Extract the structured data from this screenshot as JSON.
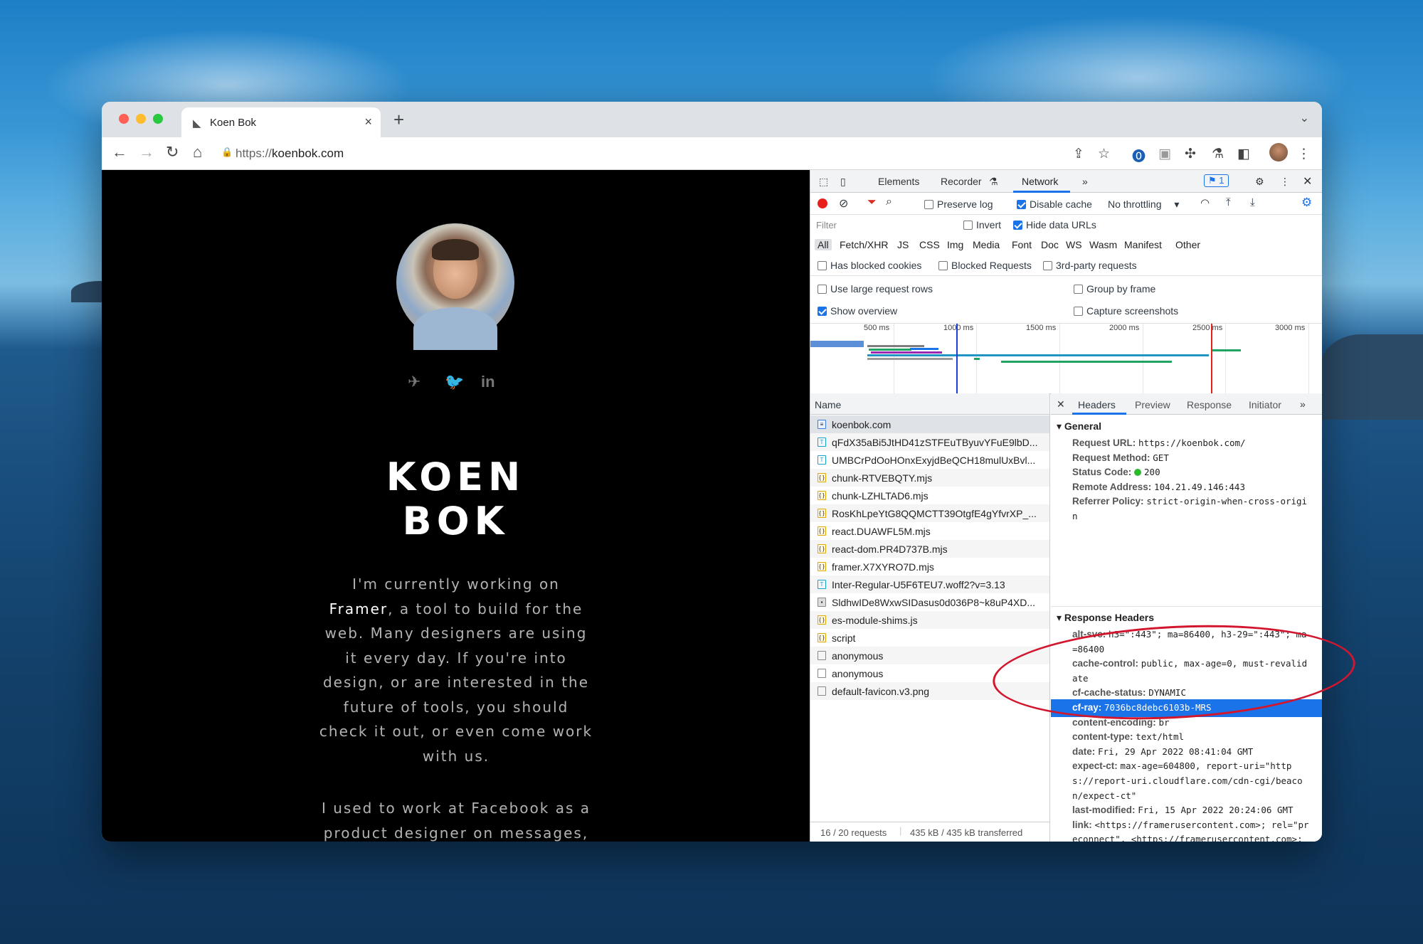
{
  "browser": {
    "tab_title": "Koen Bok",
    "new_tab": "+",
    "url_scheme": "https://",
    "url_host": "koenbok.com"
  },
  "page": {
    "name_line1": "KOEN",
    "name_line2": "BOK",
    "bio_lines": [
      "I'm currently working on",
      "Framer, a tool to build for the",
      "web. Many designers are using",
      "it every day. If you're into",
      "design, or are interested in the",
      "future of tools, you should",
      "check it out, or even come work",
      "with us."
    ],
    "bio_link": "Framer",
    "bio2_lines": [
      "I used to work at Facebook as a",
      "product designer on messages,"
    ]
  },
  "devtools": {
    "tabs": [
      "Elements",
      "Recorder",
      "Network"
    ],
    "active_tab": "Network",
    "more": "»",
    "issues_count": "1",
    "toolbar": {
      "preserve_log": "Preserve log",
      "disable_cache": "Disable cache",
      "throttling": "No throttling"
    },
    "filter": {
      "placeholder": "Filter",
      "invert": "Invert",
      "hide_data_urls": "Hide data URLs"
    },
    "types": [
      "All",
      "Fetch/XHR",
      "JS",
      "CSS",
      "Img",
      "Media",
      "Font",
      "Doc",
      "WS",
      "Wasm",
      "Manifest",
      "Other"
    ],
    "options": {
      "blocked_cookies": "Has blocked cookies",
      "blocked_requests": "Blocked Requests",
      "third_party": "3rd-party requests",
      "large_rows": "Use large request rows",
      "group_by_frame": "Group by frame",
      "show_overview": "Show overview",
      "capture_screenshots": "Capture screenshots"
    },
    "overview_ticks": [
      "500 ms",
      "1000 ms",
      "1500 ms",
      "2000 ms",
      "2500 ms",
      "3000 ms"
    ],
    "name_header": "Name",
    "requests": [
      {
        "name": "koenbok.com",
        "type": "doc"
      },
      {
        "name": "qFdX35aBi5JtHD41zSTFEuTByuvYFuE9lbD...",
        "type": "font"
      },
      {
        "name": "UMBCrPdOoHOnxExyjdBeQCH18mulUxBvl...",
        "type": "font"
      },
      {
        "name": "chunk-RTVEBQTY.mjs",
        "type": "js"
      },
      {
        "name": "chunk-LZHLTAD6.mjs",
        "type": "js"
      },
      {
        "name": "RosKhLpeYtG8QQMCTT39OtgfE4gYfvrXP_...",
        "type": "js"
      },
      {
        "name": "react.DUAWFL5M.mjs",
        "type": "js"
      },
      {
        "name": "react-dom.PR4D737B.mjs",
        "type": "js"
      },
      {
        "name": "framer.X7XYRO7D.mjs",
        "type": "js"
      },
      {
        "name": "Inter-Regular-U5F6TEU7.woff2?v=3.13",
        "type": "font"
      },
      {
        "name": "SldhwIDe8WxwSIDasus0d036P8~k8uP4XD...",
        "type": "img"
      },
      {
        "name": "es-module-shims.js",
        "type": "js"
      },
      {
        "name": "script",
        "type": "js"
      },
      {
        "name": "anonymous",
        "type": "other"
      },
      {
        "name": "anonymous",
        "type": "other"
      },
      {
        "name": "default-favicon.v3.png",
        "type": "other"
      }
    ],
    "status_requests": "16 / 20 requests",
    "status_transferred": "435 kB / 435 kB transferred",
    "detail_tabs": [
      "Headers",
      "Preview",
      "Response",
      "Initiator"
    ],
    "general_title": "General",
    "general": [
      {
        "k": "Request URL:",
        "v": "https://koenbok.com/"
      },
      {
        "k": "Request Method:",
        "v": "GET"
      },
      {
        "k": "Status Code:",
        "v": "200"
      },
      {
        "k": "Remote Address:",
        "v": "104.21.49.146:443"
      },
      {
        "k": "Referrer Policy:",
        "v": "strict-origin-when-cross-origi"
      }
    ],
    "general_wrap": "n",
    "response_title": "Response Headers",
    "response": [
      {
        "k": "alt-svc:",
        "v": "h3=\":443\"; ma=86400, h3-29=\":443\"; ma"
      },
      {
        "k": "",
        "v": "=86400"
      },
      {
        "k": "cache-control:",
        "v": "public, max-age=0, must-revalid"
      },
      {
        "k": "",
        "v": "ate"
      },
      {
        "k": "cf-cache-status:",
        "v": "DYNAMIC"
      },
      {
        "k": "cf-ray:",
        "v": "7036bc8debc6103b-MRS"
      },
      {
        "k": "content-encoding:",
        "v": "br"
      },
      {
        "k": "content-type:",
        "v": "text/html"
      },
      {
        "k": "date:",
        "v": "Fri, 29 Apr 2022 08:41:04 GMT"
      },
      {
        "k": "expect-ct:",
        "v": "max-age=604800, report-uri=\"http"
      },
      {
        "k": "",
        "v": "s://report-uri.cloudflare.com/cdn-cgi/beaco"
      },
      {
        "k": "",
        "v": "n/expect-ct\""
      },
      {
        "k": "last-modified:",
        "v": "Fri, 15 Apr 2022 20:24:06 GMT"
      },
      {
        "k": "link:",
        "v": "<https://framerusercontent.com>; rel=\"pr"
      },
      {
        "k": "",
        "v": "econnect\", <https://framerusercontent.com>;"
      }
    ]
  },
  "colors": {
    "accent": "#1a73e8",
    "annotation_ring": "#d2162d",
    "status_ok": "#2eb82e"
  }
}
